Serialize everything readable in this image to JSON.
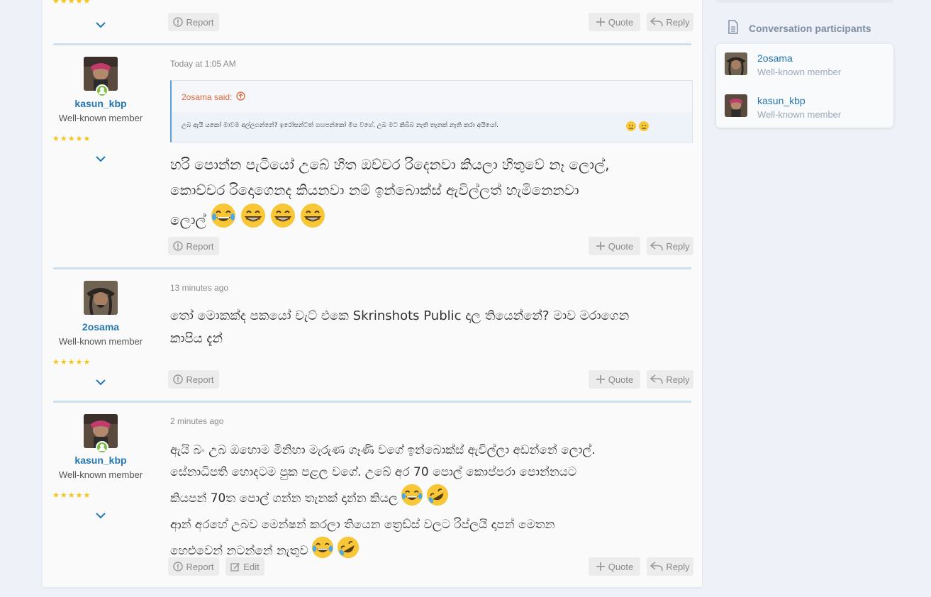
{
  "actions": {
    "report": "Report",
    "quote": "Quote",
    "reply": "Reply",
    "edit": "Edit"
  },
  "posts": [
    {
      "author": "kasun_kbp",
      "title": "Well-known member",
      "date": "Today at 1:05 AM",
      "quote": {
        "attribution": "2osama said:",
        "text": "උබ ඇයි යකෝ මාවම අල්ලගන්නේ? ඉරෝසන්ටත් ගහපන්කෝ මිය වගේ. උබ මට කිබ්බ නැති තැනක් නැති කරා අයියෝ."
      },
      "lines": [
        "හරි පොන්න පැටියෝ උබේ හිත ඔච්චර රිදෙනවා කියලා හිතුවේ නෑ ලොල්,",
        "කොච්චර රිදොගෙනද කියනවා නම් ඉන්බොක්ස් ඇවිල්ලත් හැමිනෙනවා",
        "ලොල්"
      ]
    },
    {
      "author": "2osama",
      "title": "Well-known member",
      "date": "13 minutes ago",
      "lines": [
        "තෝ මොකක්ද පකයෝ චැට් එකෙ Skrinshots Public දාල තියෙන්නේ? මාව මරාගෙන",
        "කාපිය දැන්"
      ]
    },
    {
      "author": "kasun_kbp",
      "title": "Well-known member",
      "date": "2 minutes ago",
      "lines": [
        "ඇයි බං උබ ඔහොම මිනිහා මැරුණ ගෑණි වගේ ඉන්බොක්ස් ඇවිල්ලා අඩන්නේ ලොල්.",
        "සේනාධිපති හොදටම පුක පළල වගේ. උබේ අර 70 පොල් කොප්පරා පොන්නයට",
        "කියපන් 70ත පොල් ගන්න තැනක් දාන්න කියල",
        "ආන් අරහේ උබව මෙන්ෂන් කරලා තියෙන ත්‍රෙඩ්ස් වලට රිප්ලයි දාපන් මෙතන",
        "හෙළුවෙන් නටන්නේ නැතුව"
      ]
    }
  ],
  "sidebar": {
    "heading": "Conversation participants",
    "participants": [
      {
        "name": "2osama",
        "title": "Well-known member"
      },
      {
        "name": "kasun_kbp",
        "title": "Well-known member"
      }
    ]
  }
}
